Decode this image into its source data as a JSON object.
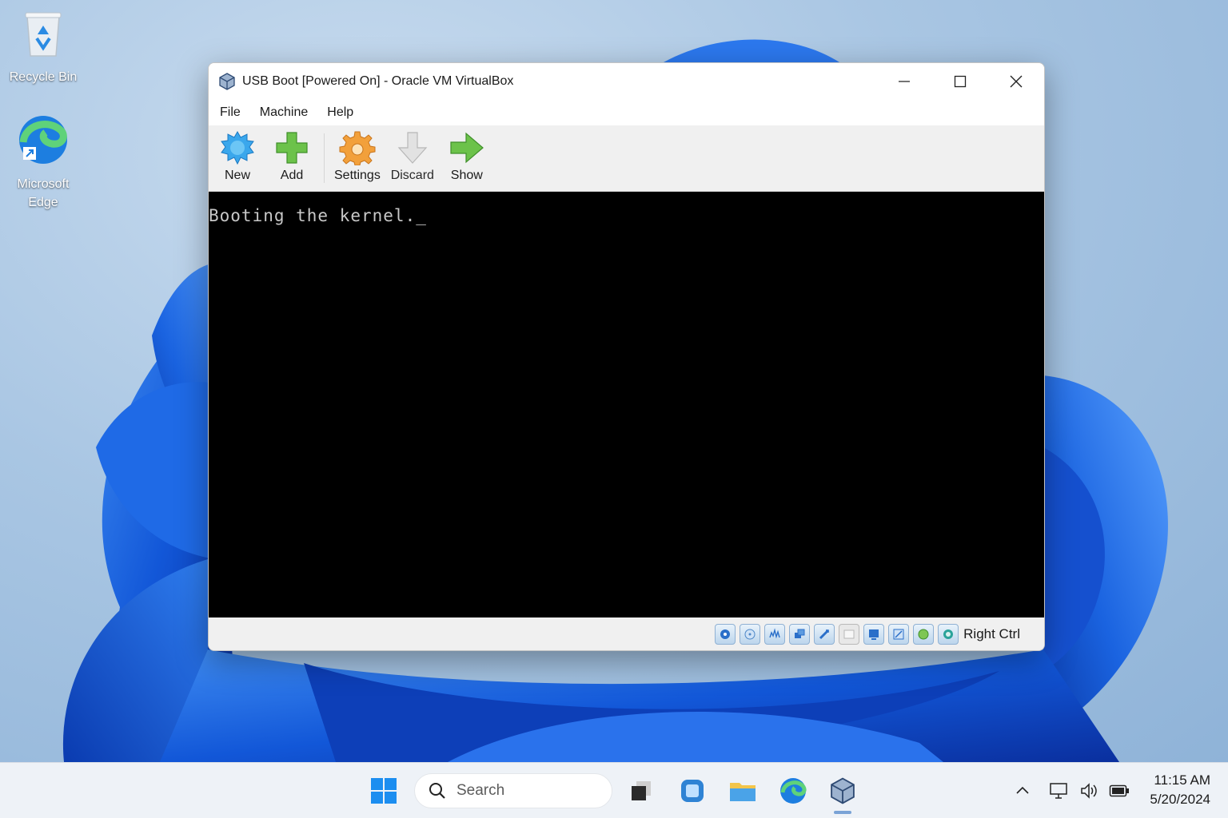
{
  "desktop": {
    "icons": [
      {
        "label": "Recycle Bin"
      },
      {
        "label": "Microsoft Edge"
      }
    ]
  },
  "window": {
    "title": "USB Boot [Powered On] - Oracle VM VirtualBox",
    "menu": [
      "File",
      "Machine",
      "Help"
    ],
    "toolbar": {
      "new_label": "New",
      "add_label": "Add",
      "settings_label": "Settings",
      "discard_label": "Discard",
      "show_label": "Show"
    },
    "console_text": "Booting the kernel.",
    "status": {
      "host_key": "Right Ctrl",
      "icons": [
        "hard-disk-icon",
        "optical-drive-icon",
        "audio-icon",
        "network-icon",
        "usb-icon",
        "shared-folder-icon",
        "display-icon",
        "video-capture-icon",
        "guest-additions-icon",
        "cpu-icon"
      ]
    }
  },
  "taskbar": {
    "search_placeholder": "Search",
    "time": "11:15 AM",
    "date": "5/20/2024"
  },
  "colors": {
    "accent": "#0067c0",
    "console_bg": "#000000",
    "console_text": "#c8c8c8"
  }
}
